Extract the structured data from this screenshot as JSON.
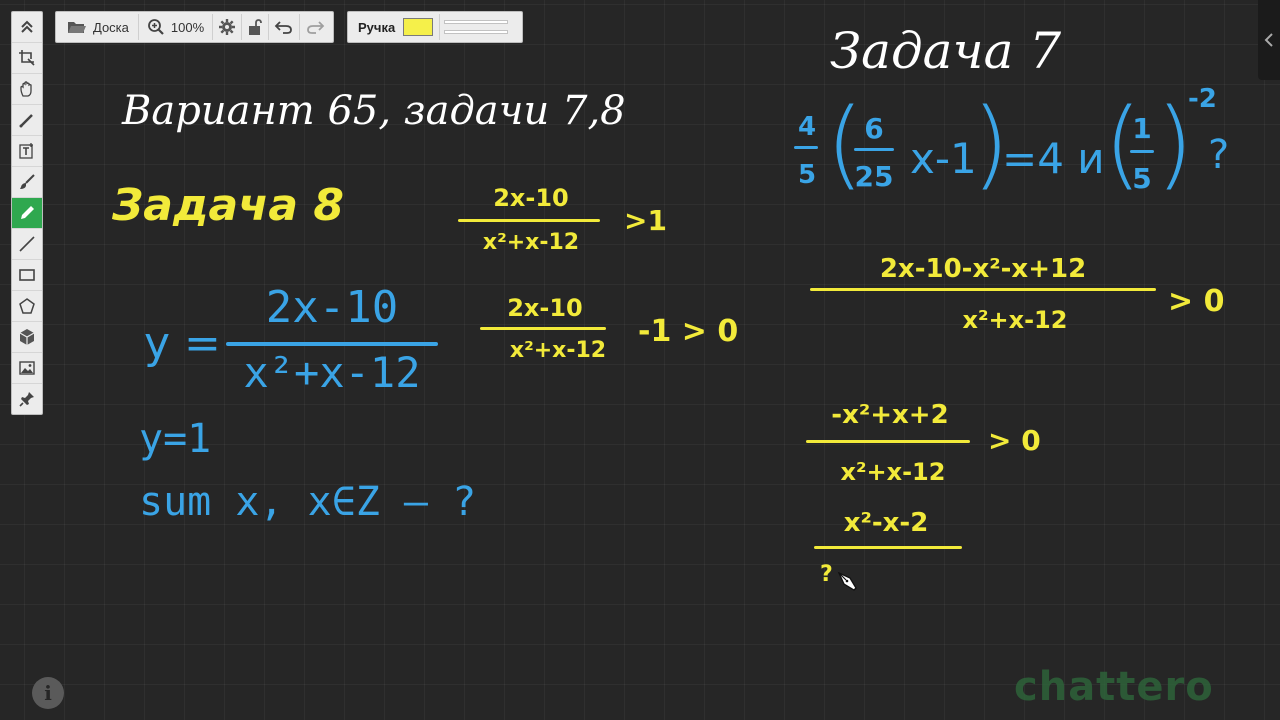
{
  "toolbar": {
    "board_label": "Доска",
    "zoom_label": "100%",
    "pen_label": "Ручка",
    "pen_color": "#f5f04a"
  },
  "board": {
    "heading": "Вариант 65, задачи 7,8",
    "task8": {
      "title": "Задача 8",
      "ineq1": {
        "num": "2x-10",
        "den": "x²+x-12",
        "rhs": ">1"
      },
      "func": {
        "lhs": "y =",
        "num": "2x-10",
        "den": "x²+x-12"
      },
      "ineq2": {
        "num": "2x-10",
        "den": "x²+x-12",
        "rhs": "-1 > 0"
      },
      "y_value": "y=1",
      "question": "sum x, x∈Z – ?"
    },
    "task7": {
      "title": "Задача 7",
      "f1_num": "4",
      "f1_den": "5",
      "f2_num": "6",
      "f2_den": "25",
      "x_part": "x-1",
      "eq_part": "=4 и",
      "f3_num": "1",
      "f3_den": "5",
      "exponent": "-2",
      "qmark": "?",
      "step1": {
        "num": "2x-10-x²-x+12",
        "den": "x²+x-12",
        "rhs": "> 0"
      },
      "step2": {
        "num": "-x²+x+2",
        "den": "x²+x-12",
        "rhs": "> 0"
      },
      "step3": {
        "num": "x²-x-2"
      },
      "partial": "?"
    }
  },
  "logo": "chattero",
  "colors": {
    "board": "#262626",
    "pen_yellow": "#f2ea3a",
    "blue_text": "#3aa4e6",
    "active_tool": "#2fa84f"
  }
}
